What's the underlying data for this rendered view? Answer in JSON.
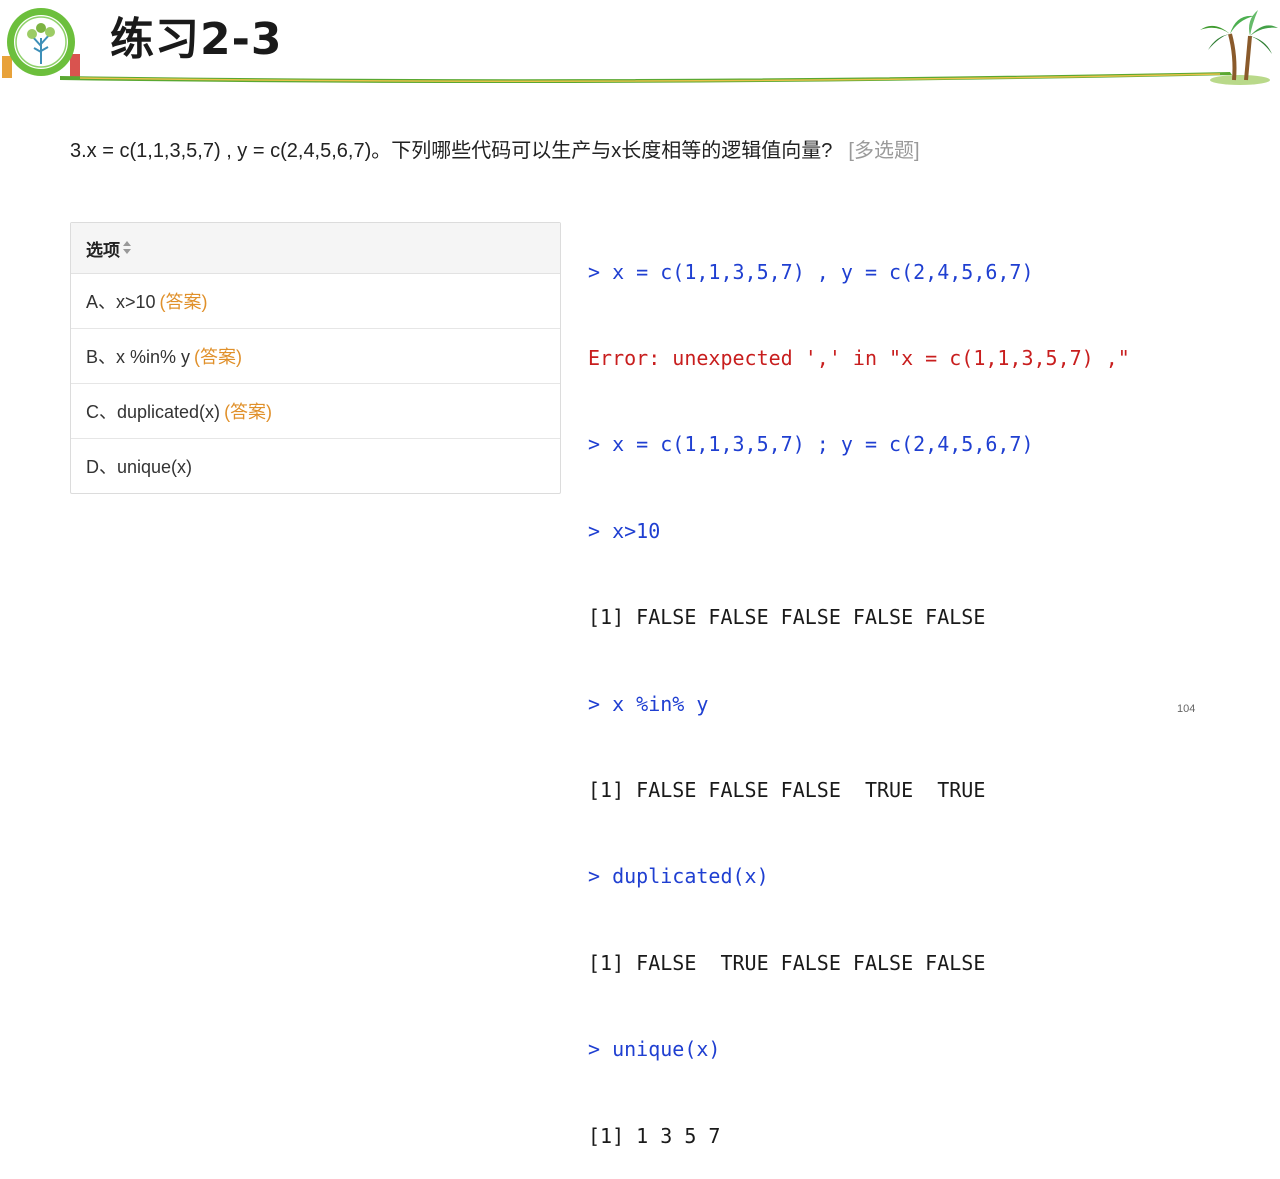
{
  "slide": {
    "title": "练习2-3",
    "page_number": "104"
  },
  "question": {
    "text": "3.x = c(1,1,3,5,7) , y = c(2,4,5,6,7)。下列哪些代码可以生产与x长度相等的逻辑值向量?",
    "tag": "[多选题]"
  },
  "options": {
    "header": "选项",
    "items": [
      {
        "label": "A、x>10",
        "answer_mark": "(答案)"
      },
      {
        "label": "B、x %in% y",
        "answer_mark": "(答案)"
      },
      {
        "label": "C、duplicated(x)",
        "answer_mark": "(答案)"
      },
      {
        "label": "D、unique(x)",
        "answer_mark": ""
      }
    ]
  },
  "console": {
    "lines": [
      {
        "type": "cmd",
        "text": "> x = c(1,1,3,5,7) , y = c(2,4,5,6,7)"
      },
      {
        "type": "err",
        "text": "Error: unexpected ',' in \"x = c(1,1,3,5,7) ,\""
      },
      {
        "type": "cmd",
        "text": "> x = c(1,1,3,5,7) ; y = c(2,4,5,6,7)"
      },
      {
        "type": "cmd",
        "text": "> x>10"
      },
      {
        "type": "out",
        "text": "[1] FALSE FALSE FALSE FALSE FALSE"
      },
      {
        "type": "cmd",
        "text": "> x %in% y"
      },
      {
        "type": "out",
        "text": "[1] FALSE FALSE FALSE  TRUE  TRUE"
      },
      {
        "type": "cmd",
        "text": "> duplicated(x)"
      },
      {
        "type": "out",
        "text": "[1] FALSE  TRUE FALSE FALSE FALSE"
      },
      {
        "type": "cmd",
        "text": "> unique(x)"
      },
      {
        "type": "out",
        "text": "[1] 1 3 5 7"
      }
    ]
  },
  "colors": {
    "command": "#1f3fd1",
    "error": "#c81e1e",
    "answer": "#e0902a",
    "accent_green": "#5aa832"
  },
  "icons": [
    "school-logo-icon",
    "palm-tree-icon",
    "sort-icon"
  ]
}
